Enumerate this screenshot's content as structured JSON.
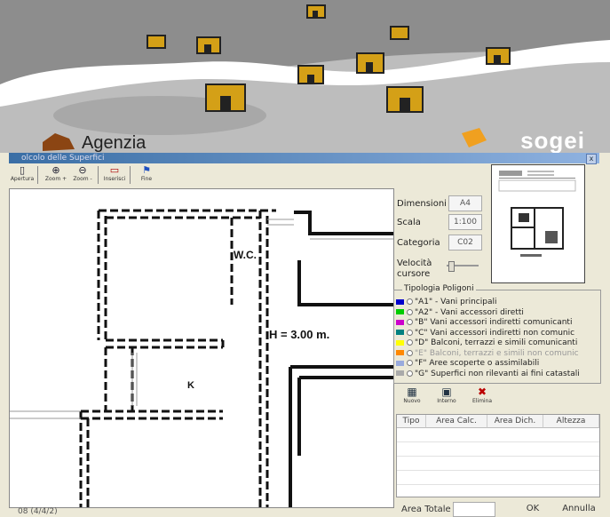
{
  "banner": {
    "agency": "Agenzia",
    "brand": "sogei"
  },
  "window": {
    "title": "olcolo delle Superfici",
    "close_label": "x"
  },
  "toolbar": {
    "items": [
      {
        "label": "Apertura",
        "icon": "folder-icon"
      },
      {
        "label": "Zoom +",
        "icon": "zoom-in-icon"
      },
      {
        "label": "Zoom -",
        "icon": "zoom-out-icon"
      },
      {
        "label": "Inserisci",
        "icon": "insert-icon"
      },
      {
        "label": "Fine",
        "icon": "flag-icon"
      }
    ]
  },
  "plan": {
    "labels": {
      "wc": "W.C.",
      "height": "H = 3.00 m.",
      "k": "K"
    }
  },
  "status": {
    "text": "08 (4/4/2)"
  },
  "properties": {
    "dimensioni_label": "Dimensioni",
    "dimensioni_value": "A4",
    "scala_label": "Scala",
    "scala_value": "1:100",
    "categoria_label": "Categoria",
    "categoria_value": "C02",
    "velocita_label_1": "Velocità",
    "velocita_label_2": "cursore",
    "velocita_value": 0.05
  },
  "polygon_types": {
    "title": "Tipologia Poligoni",
    "items": [
      {
        "label": "\"A1\" - Vani principali",
        "color": "#0000cc"
      },
      {
        "label": "\"A2\" - Vani accessori diretti",
        "color": "#00cc00"
      },
      {
        "label": "\"B\" Vani accessori indiretti comunicanti",
        "color": "#cc00cc"
      },
      {
        "label": "\"C\" Vani accessori indiretti non comunic",
        "color": "#008080"
      },
      {
        "label": "\"D\" Balconi, terrazzi e simili comunicanti",
        "color": "#ffff00"
      },
      {
        "label": "\"E\" Balconi, terrazzi e simili non comunic",
        "color": "#ff8800"
      },
      {
        "label": "\"F\" Aree scoperte o assimilabili",
        "color": "#99aadd"
      },
      {
        "label": "\"G\" Superfici non rilevanti ai fini catastali",
        "color": "#aaaaaa"
      }
    ]
  },
  "actions": {
    "nuovo": "Nuovo",
    "interno": "Interno",
    "elimina": "Elimina"
  },
  "grid": {
    "columns": [
      "Tipo",
      "Area Calc.",
      "Area Dich.",
      "Altezza"
    ]
  },
  "footer": {
    "total_label": "Area Totale",
    "total_value": "",
    "ok_label": "OK",
    "cancel_label": "Annulla"
  },
  "colors": {
    "titlebar": "#3a6ea5",
    "window_bg": "#ece9d8"
  }
}
